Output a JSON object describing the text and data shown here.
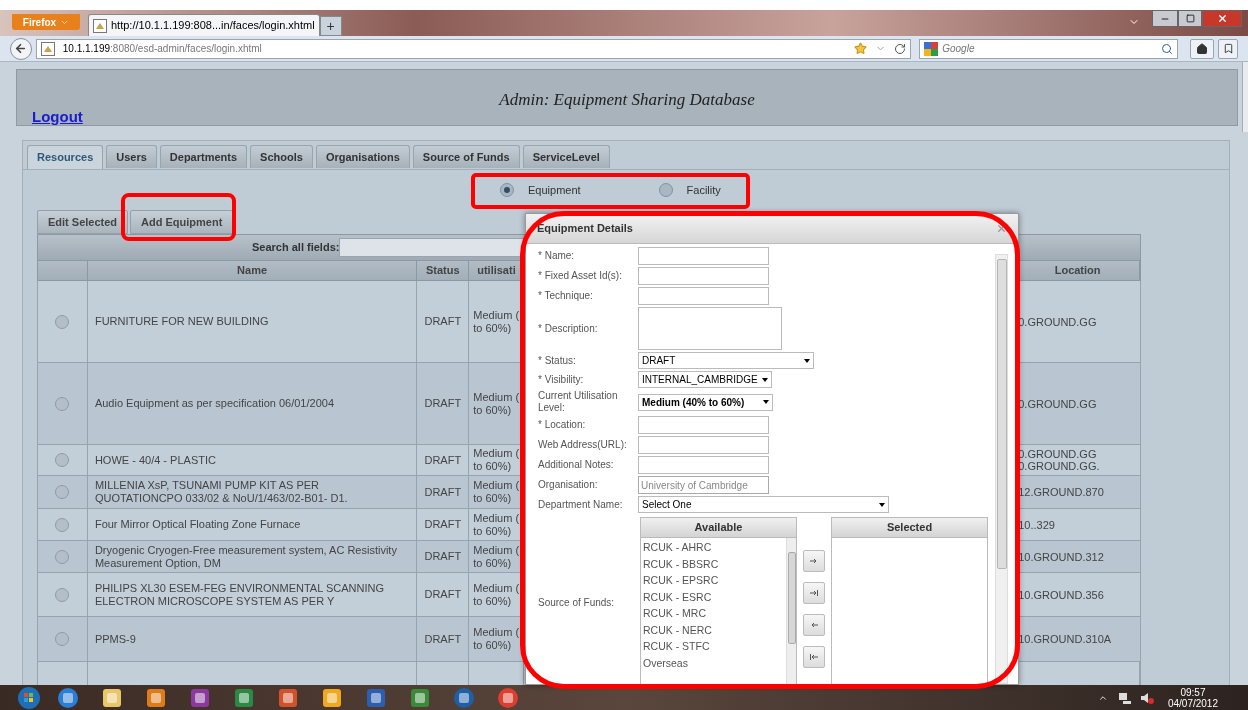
{
  "browser": {
    "menu_button": "Firefox",
    "tab_title": "http://10.1.1.199:808...in/faces/login.xhtml",
    "tab_add": "+",
    "url_host": "10.1.1.199",
    "url_path": ":8080/esd-admin/faces/login.xhtml",
    "search_placeholder": "Google"
  },
  "header": {
    "title": "Admin: Equipment Sharing Database",
    "logout": "Logout"
  },
  "tabs": [
    {
      "label": "Resources",
      "selected": true
    },
    {
      "label": "Users",
      "selected": false
    },
    {
      "label": "Departments",
      "selected": false
    },
    {
      "label": "Schools",
      "selected": false
    },
    {
      "label": "Organisations",
      "selected": false
    },
    {
      "label": "Source of Funds",
      "selected": false
    },
    {
      "label": "ServiceLevel",
      "selected": false
    }
  ],
  "resource_types": [
    {
      "label": "Equipment",
      "selected": true
    },
    {
      "label": "Facility",
      "selected": false
    }
  ],
  "actions": [
    "Edit Selected",
    "Add Equipment"
  ],
  "table": {
    "search_label": "Search all fields:",
    "columns": [
      "Name",
      "Status",
      "utilisati",
      "Location"
    ],
    "rows": [
      {
        "selected": false,
        "name": "FURNITURE FOR NEW BUILDING",
        "status": "DRAFT",
        "utilisation": [
          "Medium (",
          "to 60%)"
        ],
        "location": [
          "0.GROUND.GG"
        ]
      },
      {
        "selected": false,
        "name": "Audio Equipment as per specification 06/01/2004",
        "status": "DRAFT",
        "utilisation": [
          "Medium (",
          "to 60%)"
        ],
        "location": [
          "0.GROUND.GG"
        ]
      },
      {
        "selected": false,
        "name": "HOWE - 40/4 - PLASTIC",
        "status": "DRAFT",
        "utilisation": [
          "Medium (",
          "to 60%)"
        ],
        "location": [
          "0.GROUND.GG",
          "0.GROUND.GG."
        ]
      },
      {
        "selected": false,
        "name": "MILLENIA XsP, TSUNAMI PUMP KIT AS PER QUOTATIONCPO 033/02 & NoU/1/463/02-B01- D1.",
        "status": "DRAFT",
        "utilisation": [
          "Medium (",
          "to 60%)"
        ],
        "location": [
          "12.GROUND.870"
        ]
      },
      {
        "selected": false,
        "name": "Four Mirror Optical Floating Zone Furnace",
        "status": "DRAFT",
        "utilisation": [
          "Medium (",
          "to 60%)"
        ],
        "location": [
          "10..329"
        ]
      },
      {
        "selected": false,
        "name": "Dryogenic Cryogen-Free measurement system, AC Resistivity Measurement Option, DM",
        "status": "DRAFT",
        "utilisation": [
          "Medium (",
          "to 60%)"
        ],
        "location": [
          "10.GROUND.312"
        ]
      },
      {
        "selected": false,
        "name": "PHILIPS XL30 ESEM-FEG ENVIRONMENTAL SCANNING ELECTRON MICROSCOPE SYSTEM AS PER Y",
        "status": "DRAFT",
        "utilisation": [
          "Medium (",
          "to 60%)"
        ],
        "location": [
          "10.GROUND.356"
        ]
      },
      {
        "selected": false,
        "name": "PPMS-9",
        "status": "DRAFT",
        "utilisation": [
          "Medium (",
          "to 60%)"
        ],
        "location": [
          "10.GROUND.310A"
        ]
      }
    ]
  },
  "dialog": {
    "title": "Equipment Details",
    "fields": [
      {
        "label": "* Name:",
        "kind": "text"
      },
      {
        "label": "* Fixed Asset Id(s):",
        "kind": "text"
      },
      {
        "label": "* Technique:",
        "kind": "text"
      },
      {
        "label": "* Description:",
        "kind": "textarea"
      },
      {
        "label": "* Status:",
        "kind": "select",
        "value": "DRAFT"
      },
      {
        "label": "* Visibility:",
        "kind": "select",
        "value": "INTERNAL_CAMBRIDGE"
      },
      {
        "label": "Current Utilisation Level:",
        "kind": "select",
        "value": "Medium (40% to 60%)"
      },
      {
        "label": "* Location:",
        "kind": "text"
      },
      {
        "label": "Web Address(URL):",
        "kind": "text"
      },
      {
        "label": "Additional Notes:",
        "kind": "text"
      },
      {
        "label": "Organisation:",
        "kind": "readonly",
        "value": "University of Cambridge"
      },
      {
        "label": "Department Name:",
        "kind": "select",
        "value": "Select One"
      }
    ],
    "funds_label": "Source of Funds:",
    "available_header": "Available",
    "selected_header": "Selected",
    "available": [
      "RCUK - AHRC",
      "RCUK - BBSRC",
      "RCUK - EPSRC",
      "RCUK - ESRC",
      "RCUK - MRC",
      "RCUK - NERC",
      "RCUK - STFC",
      "Overseas"
    ]
  },
  "taskbar": {
    "time": "09:57",
    "date": "04/07/2012"
  }
}
